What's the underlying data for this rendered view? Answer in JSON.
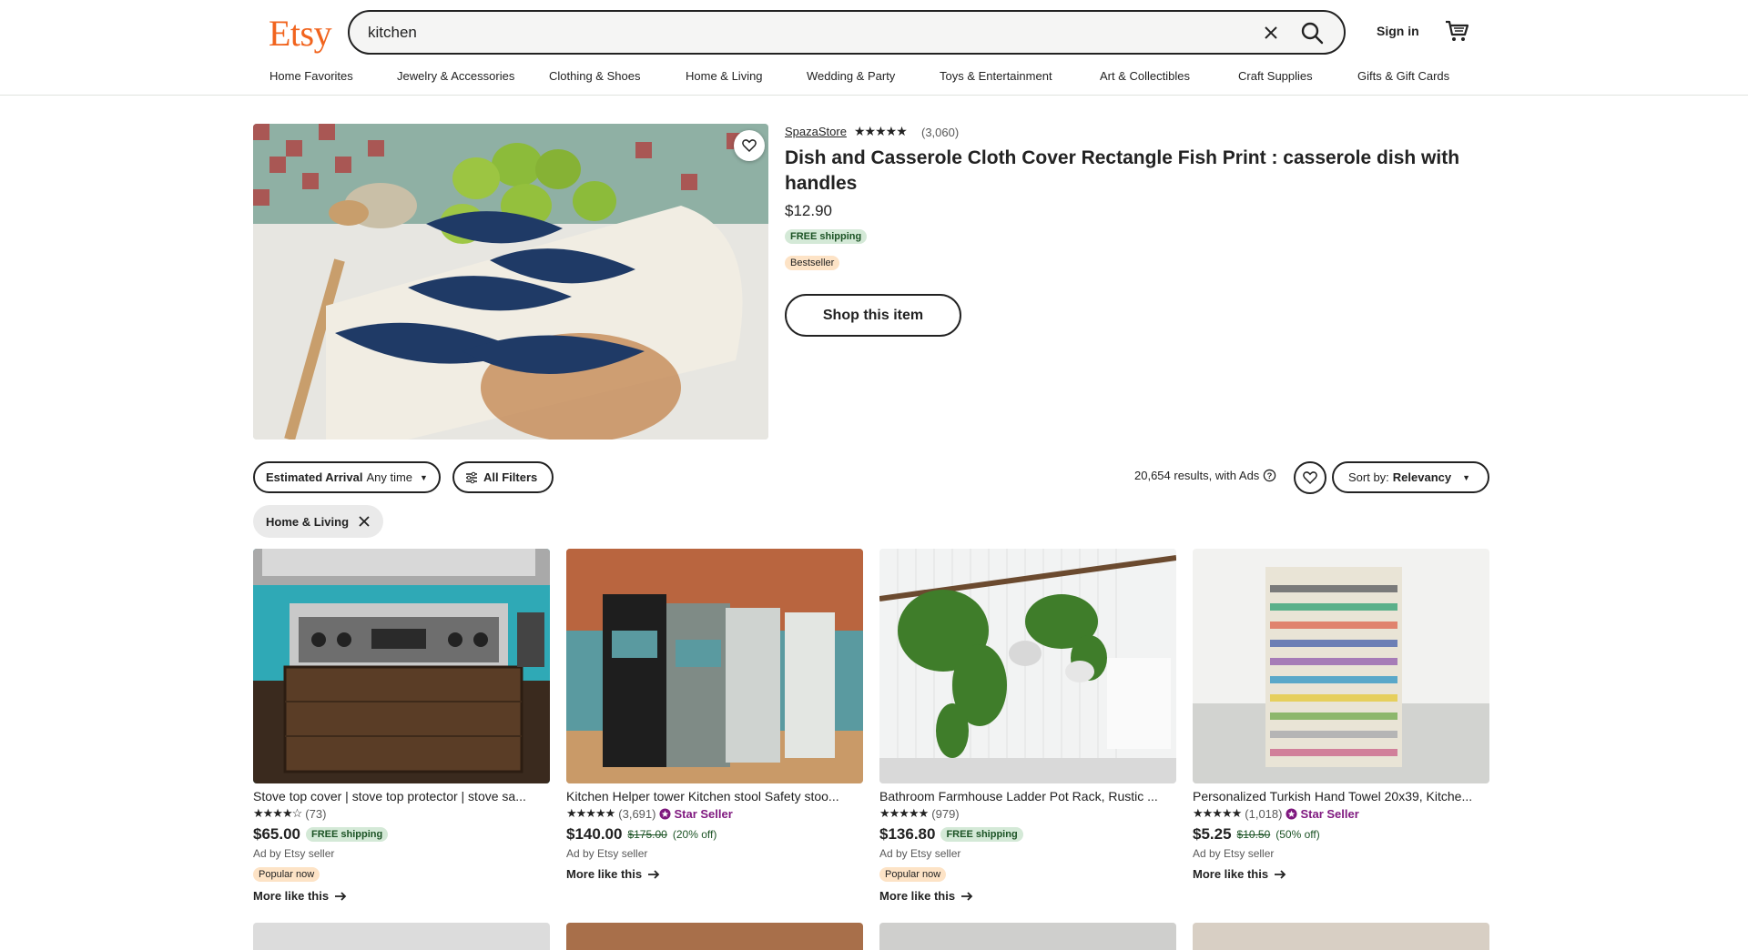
{
  "header": {
    "logo": "Etsy",
    "search_value": "kitchen",
    "signin": "Sign in",
    "nav": [
      "Home Favorites",
      "Jewelry & Accessories",
      "Clothing & Shoes",
      "Home & Living",
      "Wedding & Party",
      "Toys & Entertainment",
      "Art & Collectibles",
      "Craft Supplies",
      "Gifts & Gift Cards"
    ]
  },
  "featured": {
    "shop": "SpazaStore",
    "stars": "★★★★★",
    "review_count": "(3,060)",
    "title": "Dish and Casserole Cloth Cover Rectangle Fish Print : casserole dish with handles",
    "price": "$12.90",
    "free_shipping": "FREE shipping",
    "bestseller": "Bestseller",
    "shop_button": "Shop this item"
  },
  "filters": {
    "arrival_label": "Estimated Arrival",
    "arrival_value": "Any time",
    "all_filters": "All Filters",
    "results": "20,654 results, with Ads",
    "sort_label": "Sort by:",
    "sort_value": "Relevancy",
    "active_chip": "Home & Living"
  },
  "listings": [
    {
      "title": "Stove top cover | stove top protector | stove sa...",
      "stars": "★★★★☆",
      "reviews": "(73)",
      "price": "$65.00",
      "shipping": "FREE shipping",
      "ad": "Ad by Etsy seller",
      "badge": "Popular now",
      "more": "More like this"
    },
    {
      "title": "Kitchen Helper tower Kitchen stool Safety stoo...",
      "stars": "★★★★★",
      "reviews": "(3,691)",
      "star_seller": "Star Seller",
      "price": "$140.00",
      "original": "$175.00",
      "discount": "(20% off)",
      "ad": "Ad by Etsy seller",
      "more": "More like this"
    },
    {
      "title": "Bathroom Farmhouse Ladder Pot Rack, Rustic ...",
      "stars": "★★★★★",
      "reviews": "(979)",
      "price": "$136.80",
      "shipping": "FREE shipping",
      "ad": "Ad by Etsy seller",
      "badge": "Popular now",
      "more": "More like this"
    },
    {
      "title": "Personalized Turkish Hand Towel 20x39, Kitche...",
      "stars": "★★★★★",
      "reviews": "(1,018)",
      "star_seller": "Star Seller",
      "price": "$5.25",
      "original": "$10.50",
      "discount": "(50% off)",
      "ad": "Ad by Etsy seller",
      "more": "More like this"
    }
  ]
}
